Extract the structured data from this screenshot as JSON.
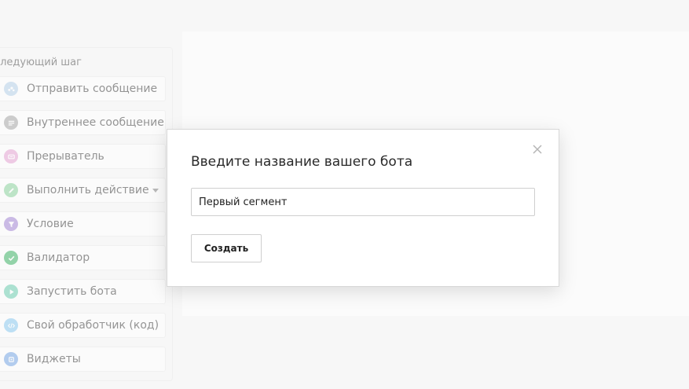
{
  "step_panel": {
    "title": "Следующий шаг",
    "items": [
      {
        "label": "Отправить сообщение",
        "icon": "message-bubble-icon",
        "color": "#b9d3ec"
      },
      {
        "label": "Внутреннее сообщение",
        "icon": "internal-message-icon",
        "color": "#a9a9a9"
      },
      {
        "label": "Прерыватель",
        "icon": "interrupter-icon",
        "color": "#e7a6d6"
      },
      {
        "label": "Выполнить действие",
        "icon": "pencil-action-icon",
        "color": "#8fd6a1"
      },
      {
        "label": "Условие",
        "icon": "filter-condition-icon",
        "color": "#a78ad8"
      },
      {
        "label": "Валидатор",
        "icon": "checkmark-validator-icon",
        "color": "#43b66b"
      },
      {
        "label": "Запустить бота",
        "icon": "play-bot-icon",
        "color": "#6fd0b3"
      },
      {
        "label": "Свой обработчик (код)",
        "icon": "code-handler-icon",
        "color": "#8fcdf2"
      },
      {
        "label": "Виджеты",
        "icon": "widget-icon",
        "color": "#7aa9e8"
      }
    ]
  },
  "modal": {
    "title": "Введите название вашего бота",
    "input_value": "Первый сегмент",
    "create_label": "Создать"
  }
}
